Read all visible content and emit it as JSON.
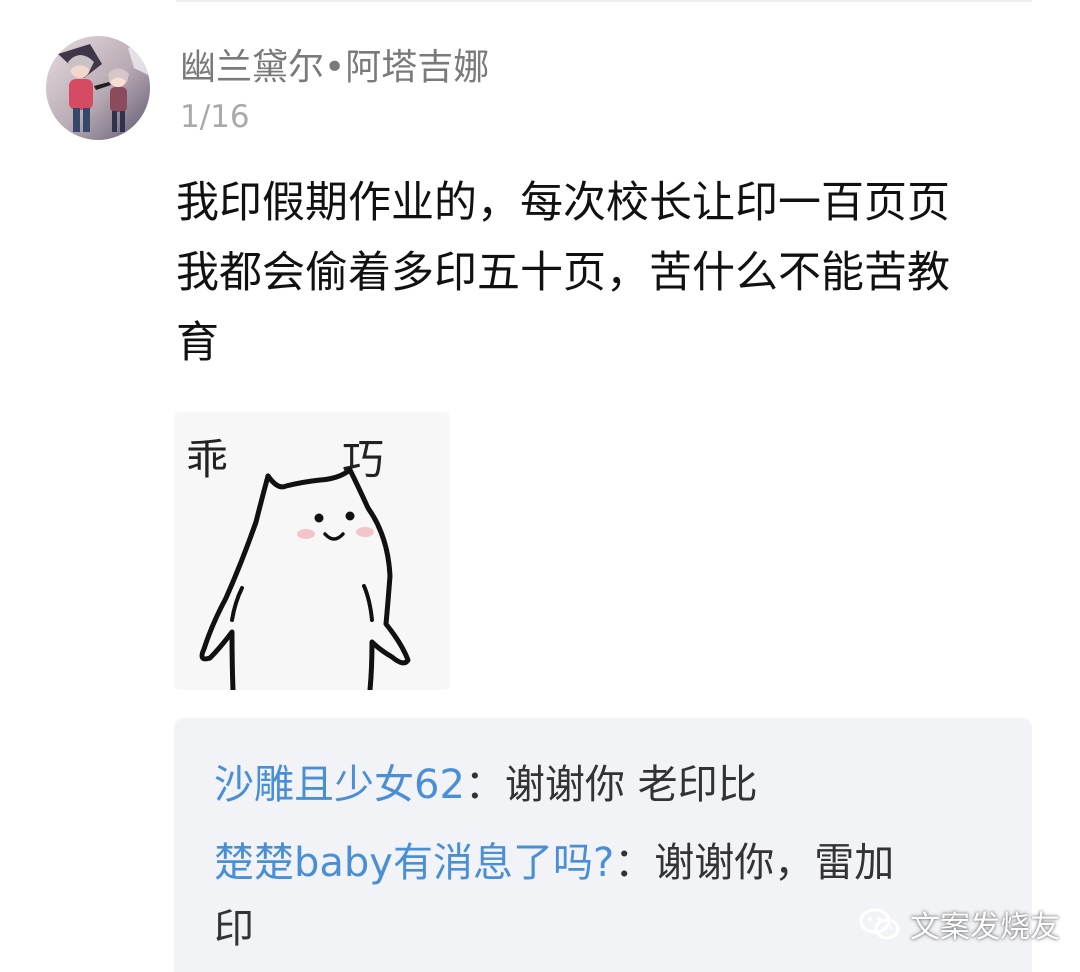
{
  "post": {
    "username": "幽兰黛尔•阿塔吉娜",
    "floor": "1/16",
    "content_lines": [
      "我印假期作业的，每次校长让印一百页页",
      "我都会偷着多印五十页，苦什么不能苦教",
      "育"
    ],
    "sticker_text": [
      "乖",
      "巧"
    ]
  },
  "replies": [
    {
      "user": "沙雕且少女62",
      "separator": "：",
      "text": "谢谢你 老印比"
    },
    {
      "user": "楚楚baby有消息了吗?",
      "separator": "：",
      "text_line1": "谢谢你，雷加",
      "text_line2": "印"
    }
  ],
  "watermark": {
    "text": "文案发烧友",
    "icon": "wechat-icon"
  },
  "colors": {
    "username": "#7a7a7a",
    "floor": "#aaaaaa",
    "reply_user": "#4a8fd6",
    "reply_bg": "#f2f3f7"
  }
}
